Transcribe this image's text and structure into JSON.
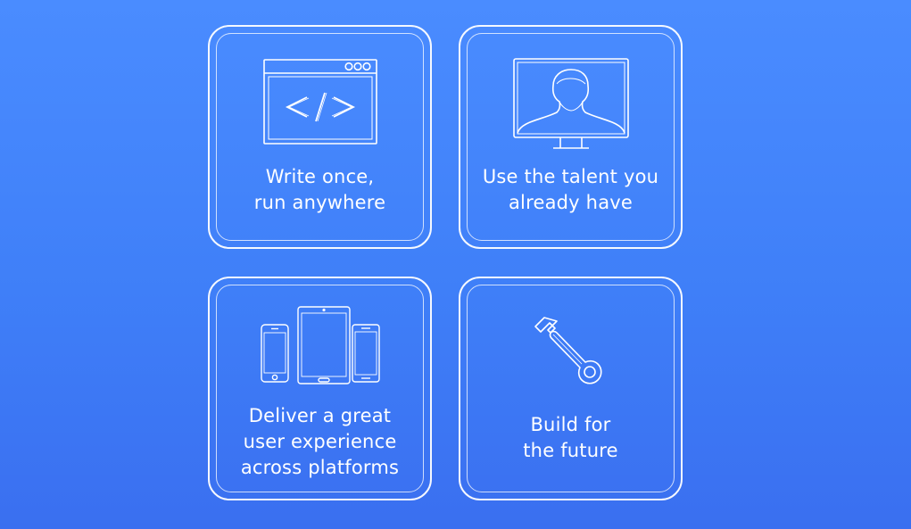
{
  "cards": [
    {
      "caption": "Write once,\nrun anywhere",
      "icon": "code-window-icon"
    },
    {
      "caption": "Use the talent you\nalready have",
      "icon": "developer-monitor-icon"
    },
    {
      "caption": "Deliver a great\nuser experience\nacross platforms",
      "icon": "devices-icon"
    },
    {
      "caption": "Build for\nthe future",
      "icon": "wrench-icon"
    }
  ],
  "colors": {
    "background_top": "#4a8cff",
    "background_bottom": "#3a6ff0",
    "foreground": "#ffffff"
  }
}
